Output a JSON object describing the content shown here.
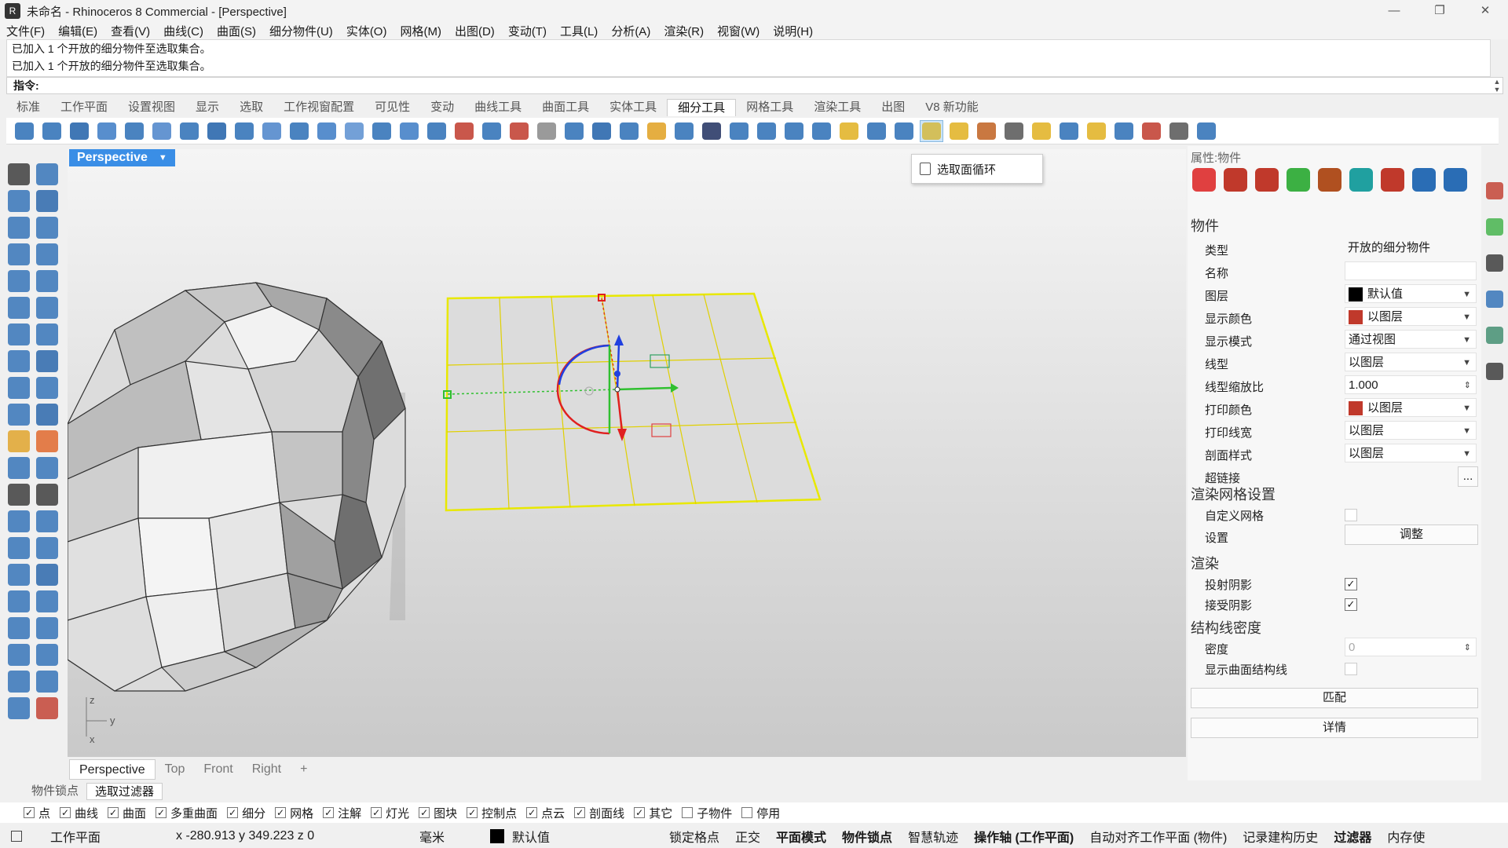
{
  "window": {
    "title": "未命名 - Rhinoceros 8 Commercial - [Perspective]",
    "controls": [
      "—",
      "❐",
      "✕"
    ]
  },
  "menu": [
    "文件(F)",
    "编辑(E)",
    "查看(V)",
    "曲线(C)",
    "曲面(S)",
    "细分物件(U)",
    "实体(O)",
    "网格(M)",
    "出图(D)",
    "变动(T)",
    "工具(L)",
    "分析(A)",
    "渲染(R)",
    "视窗(W)",
    "说明(H)"
  ],
  "history": [
    "已加入 1 个开放的细分物件至选取集合。",
    "已加入 1 个开放的细分物件至选取集合。"
  ],
  "command": {
    "label": "指令:"
  },
  "toolbar_tabs": [
    "标准",
    "工作平面",
    "设置视图",
    "显示",
    "选取",
    "工作视窗配置",
    "可见性",
    "变动",
    "曲线工具",
    "曲面工具",
    "实体工具",
    "细分工具",
    "网格工具",
    "渲染工具",
    "出图",
    "V8 新功能"
  ],
  "active_toolbar_tab": "细分工具",
  "toolbar_colors": [
    "#2a6db5",
    "#2a6db5",
    "#1f5fa8",
    "#3b7ac4",
    "#2a6db5",
    "#4a83c9",
    "#2a6db5",
    "#1f5fa8",
    "#2a6db5",
    "#4a83c9",
    "#2a6db5",
    "#3b7ac4",
    "#5a8fd0",
    "#2a6db5",
    "#3b7ac4",
    "#2a6db5",
    "#c0392b",
    "#2a6db5",
    "#c0392b",
    "#888888",
    "#2a6db5",
    "#1f5fa8",
    "#2a6db5",
    "#e0a020",
    "#2a6db5",
    "#1f2f5f",
    "#2a6db5",
    "#2a6db5",
    "#2a6db5",
    "#2a6db5",
    "#e0b020",
    "#2a6db5",
    "#2a6db5",
    "#d4b840",
    "#e0b020",
    "#c06020",
    "#555555",
    "#e0b020",
    "#2a6db5",
    "#e0b020",
    "#2a6db5",
    "#c0392b",
    "#555555",
    "#2a6db5"
  ],
  "tooltip": {
    "text": "选取面循环"
  },
  "left_tool_colors": [
    "#333333",
    "#2a6db5",
    "#2a6db5",
    "#1f5fa8",
    "#2a6db5",
    "#2a6db5",
    "#2a6db5",
    "#2a6db5",
    "#2a6db5",
    "#2a6db5",
    "#2a6db5",
    "#2a6db5",
    "#2a6db5",
    "#2a6db5",
    "#2a6db5",
    "#1f5fa8",
    "#2a6db5",
    "#2a6db5",
    "#2a6db5",
    "#1f5fa8",
    "#e0a020",
    "#e06020",
    "#2a6db5",
    "#2a6db5",
    "#333333",
    "#333333",
    "#2a6db5",
    "#2a6db5",
    "#2a6db5",
    "#2a6db5",
    "#2a6db5",
    "#1f5fa8",
    "#2a6db5",
    "#2a6db5",
    "#2a6db5",
    "#2a6db5",
    "#2a6db5",
    "#2a6db5",
    "#2a6db5",
    "#2a6db5",
    "#2a6db5",
    "#c0392b"
  ],
  "viewport": {
    "label": "Perspective",
    "axes": {
      "z": "z",
      "y": "y",
      "x": "x"
    }
  },
  "viewport_tabs": [
    "Perspective",
    "Top",
    "Front",
    "Right",
    "+"
  ],
  "properties": {
    "title": "属性:物件",
    "icon_colors": [
      "#e04040",
      "#c0392b",
      "#c0392b",
      "#3cb043",
      "#b05020",
      "#20a0a0",
      "#c0392b",
      "#2a6db5",
      "#2a6db5"
    ],
    "section_object": "物件",
    "rows": [
      {
        "label": "类型",
        "value": "开放的细分物件",
        "kind": "plain"
      },
      {
        "label": "名称",
        "value": "",
        "kind": "text"
      },
      {
        "label": "图层",
        "value": "默认值",
        "kind": "select",
        "swatch": "#000000"
      },
      {
        "label": "显示颜色",
        "value": "以图层",
        "kind": "select",
        "swatch": "#c0392b"
      },
      {
        "label": "显示模式",
        "value": "通过视图",
        "kind": "select"
      },
      {
        "label": "线型",
        "value": "以图层",
        "kind": "select"
      },
      {
        "label": "线型缩放比",
        "value": "1.000",
        "kind": "spin"
      },
      {
        "label": "打印颜色",
        "value": "以图层",
        "kind": "select",
        "swatch": "#c0392b"
      },
      {
        "label": "打印线宽",
        "value": "以图层",
        "kind": "select"
      },
      {
        "label": "剖面样式",
        "value": "以图层",
        "kind": "select"
      },
      {
        "label": "超链接",
        "value": "...",
        "kind": "button"
      }
    ],
    "section_mesh": "渲染网格设置",
    "custom_mesh_label": "自定义网格",
    "settings_label": "设置",
    "adjust_button": "调整",
    "section_render": "渲染",
    "cast_shadow_label": "投射阴影",
    "cast_shadow_checked": "✓",
    "receive_shadow_label": "接受阴影",
    "receive_shadow_checked": "✓",
    "section_isocurve": "结构线密度",
    "density_label": "密度",
    "density_value": "0",
    "show_iso_label": "显示曲面结构线",
    "match_button": "匹配",
    "details_button": "详情"
  },
  "right_strip_colors": [
    "#c0392b",
    "#3cb043",
    "#333333",
    "#2a6db5",
    "#3a8a6a",
    "#333333"
  ],
  "filter_tabs": [
    "物件锁点",
    "选取过滤器"
  ],
  "active_filter_tab": "选取过滤器",
  "filters": [
    {
      "label": "点",
      "checked": "✓"
    },
    {
      "label": "曲线",
      "checked": "✓"
    },
    {
      "label": "曲面",
      "checked": "✓"
    },
    {
      "label": "多重曲面",
      "checked": "✓"
    },
    {
      "label": "细分",
      "checked": "✓"
    },
    {
      "label": "网格",
      "checked": "✓"
    },
    {
      "label": "注解",
      "checked": "✓"
    },
    {
      "label": "灯光",
      "checked": "✓"
    },
    {
      "label": "图块",
      "checked": "✓"
    },
    {
      "label": "控制点",
      "checked": "✓"
    },
    {
      "label": "点云",
      "checked": "✓"
    },
    {
      "label": "剖面线",
      "checked": "✓"
    },
    {
      "label": "其它",
      "checked": "✓"
    },
    {
      "label": "子物件",
      "checked": ""
    },
    {
      "label": "停用",
      "checked": ""
    }
  ],
  "status": {
    "cplane": "工作平面",
    "coords": "x -280.913  y 349.223  z 0",
    "units": "毫米",
    "layer": "默认值",
    "layer_color": "#000000",
    "toggles": [
      {
        "label": "锁定格点",
        "bold": false
      },
      {
        "label": "正交",
        "bold": false
      },
      {
        "label": "平面模式",
        "bold": true
      },
      {
        "label": "物件锁点",
        "bold": true
      },
      {
        "label": "智慧轨迹",
        "bold": false
      },
      {
        "label": "操作轴 (工作平面)",
        "bold": true
      },
      {
        "label": "自动对齐工作平面 (物件)",
        "bold": false
      },
      {
        "label": "记录建构历史",
        "bold": false
      },
      {
        "label": "过滤器",
        "bold": true
      },
      {
        "label": "内存使",
        "bold": false
      }
    ]
  }
}
